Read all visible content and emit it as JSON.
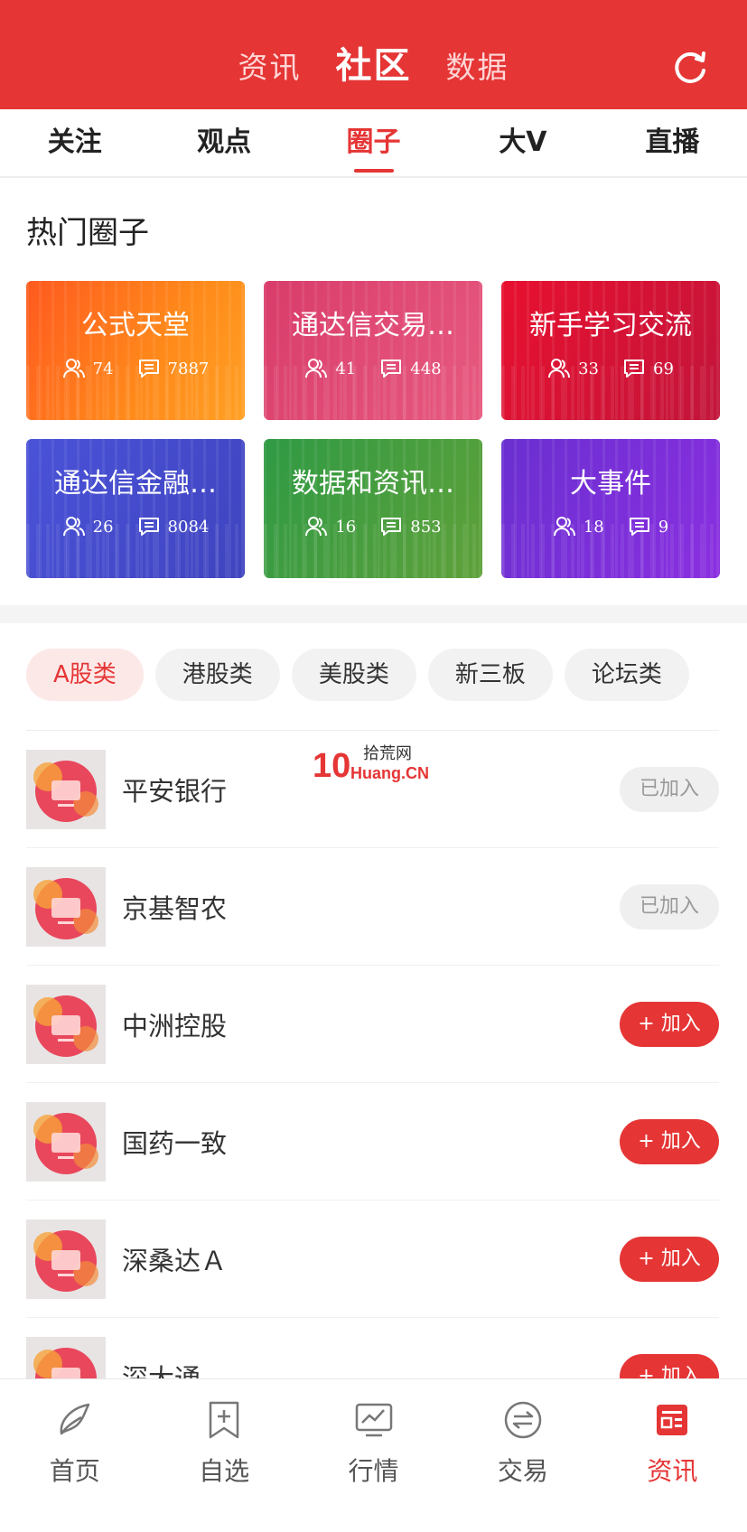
{
  "header": {
    "tabs": [
      {
        "label": "资讯",
        "active": false
      },
      {
        "label": "社区",
        "active": true
      },
      {
        "label": "数据",
        "active": false
      }
    ],
    "refresh_icon": "refresh-icon"
  },
  "sub_tabs": [
    {
      "label": "关注",
      "active": false
    },
    {
      "label": "观点",
      "active": false
    },
    {
      "label": "圈子",
      "active": true
    },
    {
      "label": "大V",
      "active": false
    },
    {
      "label": "直播",
      "active": false
    }
  ],
  "hot_section": {
    "title": "热门圈子",
    "cards": [
      {
        "name": "公式天堂",
        "members": "74",
        "posts": "7887",
        "color": "orange"
      },
      {
        "name": "通达信交易…",
        "members": "41",
        "posts": "448",
        "color": "pink"
      },
      {
        "name": "新手学习交流",
        "members": "33",
        "posts": "69",
        "color": "red"
      },
      {
        "name": "通达信金融…",
        "members": "26",
        "posts": "8084",
        "color": "blue"
      },
      {
        "name": "数据和资讯…",
        "members": "16",
        "posts": "853",
        "color": "green"
      },
      {
        "name": "大事件",
        "members": "18",
        "posts": "9",
        "color": "purple"
      }
    ]
  },
  "categories": [
    {
      "label": "A股类",
      "active": true
    },
    {
      "label": "港股类",
      "active": false
    },
    {
      "label": "美股类",
      "active": false
    },
    {
      "label": "新三板",
      "active": false
    },
    {
      "label": "论坛类",
      "active": false
    }
  ],
  "circle_list": [
    {
      "name": "平安银行",
      "button": "已加入",
      "joined": true
    },
    {
      "name": "京基智农",
      "button": "已加入",
      "joined": true
    },
    {
      "name": "中洲控股",
      "button": "+ 加入",
      "joined": false
    },
    {
      "name": "国药一致",
      "button": "+ 加入",
      "joined": false
    },
    {
      "name": "深桑达Ａ",
      "button": "+ 加入",
      "joined": false
    },
    {
      "name": "深大通",
      "button": "+ 加入",
      "joined": false
    }
  ],
  "watermark": {
    "line1": "拾荒网",
    "line2": "Huang.CN",
    "mark": "10"
  },
  "bottom_nav": [
    {
      "label": "首页",
      "icon": "home-icon",
      "active": false
    },
    {
      "label": "自选",
      "icon": "watchlist-icon",
      "active": false
    },
    {
      "label": "行情",
      "icon": "market-chart-icon",
      "active": false
    },
    {
      "label": "交易",
      "icon": "trade-exchange-icon",
      "active": false
    },
    {
      "label": "资讯",
      "icon": "news-icon",
      "active": true
    }
  ],
  "colors": {
    "accent": "#e53535",
    "chip_active_bg": "#fde8e8",
    "joined_bg": "#efefef"
  }
}
